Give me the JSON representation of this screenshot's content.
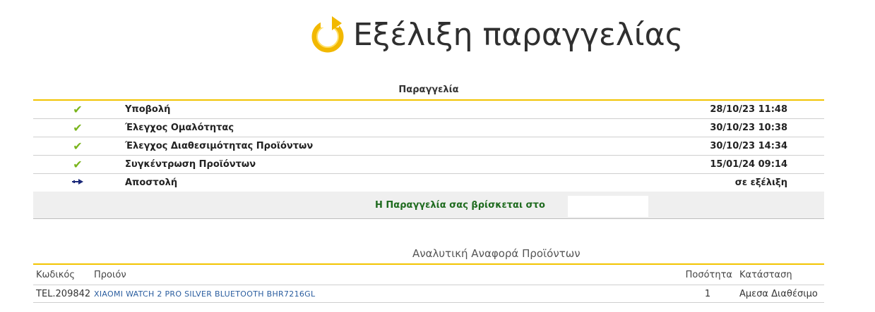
{
  "header": {
    "title": "Εξέλιξη παραγγελίας",
    "icon": "refresh-icon"
  },
  "order": {
    "caption": "Παραγγελία",
    "steps": [
      {
        "icon": "check-icon",
        "label": "Υποβολή",
        "date": "28/10/23 11:48"
      },
      {
        "icon": "check-icon",
        "label": "Έλεγχος Ομαλότητας",
        "date": "30/10/23 10:38"
      },
      {
        "icon": "check-icon",
        "label": "Έλεγχος Διαθεσιμότητας Προϊόντων",
        "date": "30/10/23 14:34"
      },
      {
        "icon": "check-icon",
        "label": "Συγκέντρωση Προϊόντων",
        "date": "15/01/24 09:14"
      },
      {
        "icon": "arrow-right-icon",
        "label": "Αποστολή",
        "date": "σε εξέλιξη"
      }
    ],
    "status_text": "Η Παραγγελία σας βρίσκεται στο",
    "status_value": ""
  },
  "report": {
    "caption": "Αναλυτική Αναφορά Προϊόντων",
    "columns": {
      "code": "Κωδικός",
      "product": "Προιόν",
      "qty": "Ποσότητα",
      "status": "Κατάσταση"
    },
    "rows": [
      {
        "code": "TEL.209842",
        "product": "XIAOMI WATCH 2 PRO SILVER BLUETOOTH BHR7216GL",
        "qty": "1",
        "status": "Αμεσα Διαθέσιμο"
      }
    ]
  },
  "colors": {
    "accent": "#f2c400",
    "check": "#7ab51d",
    "arrow": "#1c2a7a",
    "status_text": "#1f6b1f",
    "link": "#2a5d9f"
  }
}
